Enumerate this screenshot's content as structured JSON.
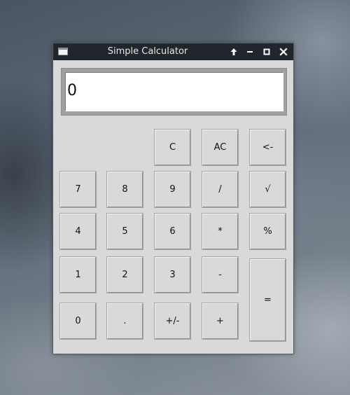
{
  "window": {
    "title": "Simple Calculator"
  },
  "titlebar_buttons": {
    "keep_above": "↑",
    "minimize": "–",
    "maximize": "□",
    "close": "✕"
  },
  "display": {
    "value": "0"
  },
  "keys": {
    "clear": "C",
    "all_clear": "AC",
    "backspace": "<-",
    "seven": "7",
    "eight": "8",
    "nine": "9",
    "divide": "/",
    "sqrt": "√",
    "four": "4",
    "five": "5",
    "six": "6",
    "multiply": "*",
    "percent": "%",
    "one": "1",
    "two": "2",
    "three": "3",
    "minus": "-",
    "equals": "=",
    "zero": "0",
    "decimal": ".",
    "negate": "+/-",
    "plus": "+"
  }
}
